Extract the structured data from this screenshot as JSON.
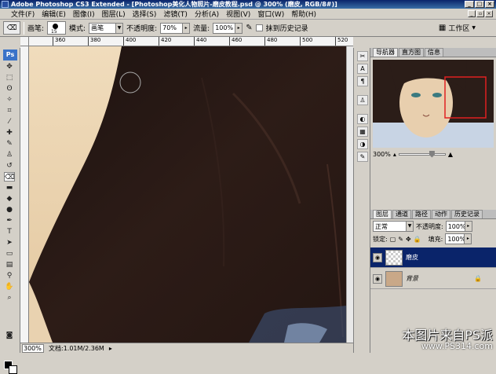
{
  "titlebar": {
    "title": "Adobe Photoshop CS3 Extended - [Photoshop美化人物照片-磨皮教程.psd @ 300% (磨皮, RGB/8#)]"
  },
  "menu": [
    "文件(F)",
    "编辑(E)",
    "图像(I)",
    "图层(L)",
    "选择(S)",
    "滤镜(T)",
    "分析(A)",
    "视图(V)",
    "窗口(W)",
    "帮助(H)"
  ],
  "options": {
    "brush_label": "画笔:",
    "brush_size": "15",
    "mode_label": "模式:",
    "mode_value": "画笔",
    "opacity_label": "不透明度:",
    "opacity_value": "70%",
    "flow_label": "流量:",
    "flow_value": "100%",
    "history_label": "抹到历史记录",
    "workspace_label": "工作区"
  },
  "ruler": {
    "ticks": [
      "360",
      "380",
      "400",
      "420",
      "440",
      "460",
      "480",
      "500",
      "520"
    ]
  },
  "status": {
    "zoom": "300%",
    "doc": "文档:1.01M/2.36M"
  },
  "navigator": {
    "tabs": [
      "导航器",
      "直方图",
      "信息"
    ],
    "zoom": "300%"
  },
  "layers": {
    "tabs": [
      "图层",
      "通道",
      "路径",
      "动作",
      "历史记录"
    ],
    "blend_mode": "正常",
    "opacity_label": "不透明度:",
    "opacity_value": "100%",
    "lock_label": "锁定:",
    "fill_label": "填充:",
    "fill_value": "100%",
    "items": [
      {
        "name": "磨皮",
        "selected": true
      },
      {
        "name": "背景",
        "selected": false
      }
    ]
  },
  "watermark": {
    "line1": "本图片来自PS派",
    "line2": "www.PS314.com"
  },
  "toolbox": {
    "logo": "Ps"
  }
}
